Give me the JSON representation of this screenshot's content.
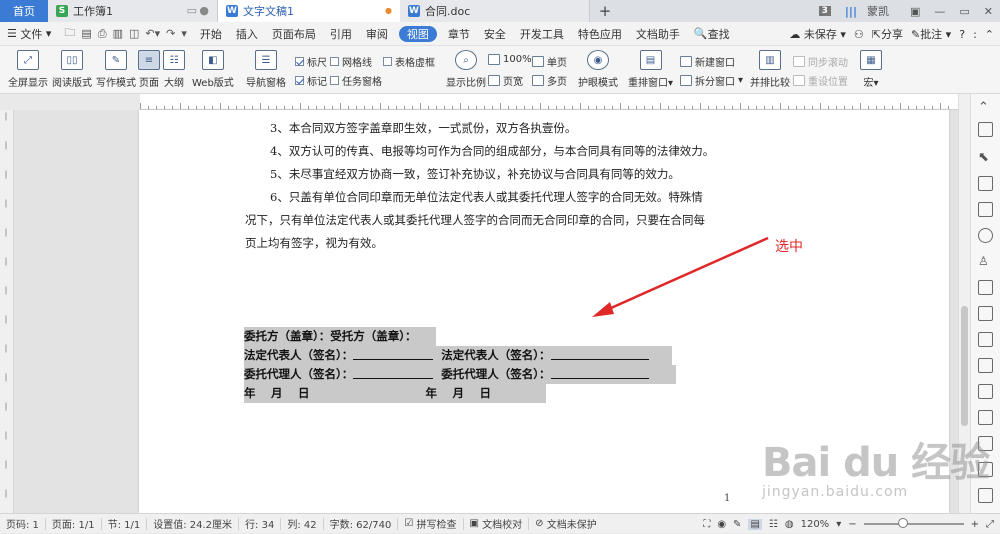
{
  "tabs": {
    "home": "首页",
    "sheet": "工作簿1",
    "doc": "文字文稿1",
    "contract": "合同.doc",
    "badge": "3",
    "user": "蒙凯"
  },
  "menu": {
    "file": "文件",
    "items": [
      "开始",
      "插入",
      "页面布局",
      "引用",
      "审阅",
      "视图",
      "章节",
      "安全",
      "开发工具",
      "特色应用",
      "文档助手"
    ],
    "active_index": 5,
    "search": "查找",
    "unsaved": "未保存",
    "share": "分享",
    "annotate": "批注",
    "help": "?"
  },
  "ribbon": {
    "fullscreen": "全屏显示",
    "reading": "阅读版式",
    "writing": "写作模式",
    "page": "页面",
    "outline": "大纲",
    "web": "Web版式",
    "nav": "导航窗格",
    "ruler": "标尺",
    "gridlines": "网格线",
    "table_lines": "表格虚框",
    "marks": "标记",
    "task_pane": "任务窗格",
    "zoom_ratio": "显示比例",
    "hundred": "100%",
    "page_width": "页宽",
    "single_page": "单页",
    "multi_page": "多页",
    "eye_mode": "护眼模式",
    "rearrange": "重排窗口",
    "new_window": "新建窗口",
    "split_window": "拆分窗口",
    "side_by_side": "并排比较",
    "sync_scroll": "同步滚动",
    "reset_pos": "重设位置",
    "macro": "宏"
  },
  "document": {
    "paragraphs": [
      "3、本合同双方签字盖章即生效，一式贰份，双方各执壹份。",
      "4、双方认可的传真、电报等均可作为合同的组成部分，与本合同具有同等的法律效力。",
      "5、未尽事宜经双方协商一致，签订补充协议，补充协议与合同具有同等的效力。",
      "6、只盖有单位合同印章而无单位法定代表人或其委托代理人签字的合同无效。特殊情",
      "况下，只有单位法定代表人或其委托代理人签字的合同而无合同印章的合同，只要在合同每",
      "页上均有签字，视为有效。"
    ],
    "selected": {
      "row1": "委托方（盖章）：受托方（盖章）：",
      "row2a": "法定代表人（签名）：",
      "row2b": "法定代表人（签名）：",
      "row3a": "委托代理人（签名）：",
      "row3b": "委托代理人（签名）：",
      "row4a": "年　 月　 日",
      "row4b": "年　 月　 日"
    },
    "page_number": "1",
    "annotation": "选中"
  },
  "status": {
    "page_code": "页码: 1",
    "pages": "页面: 1/1",
    "section": "节: 1/1",
    "setting": "设置值: 24.2厘米",
    "row": "行: 34",
    "col": "列: 42",
    "chars": "字数: 62/740",
    "spell": "拼写检查",
    "proof": "文档校对",
    "protect": "文档未保护",
    "zoom": "120%",
    "zoom_out": "−",
    "zoom_in": "+"
  },
  "watermark": {
    "brand": "Bai du 经验",
    "url": "jingyan.baidu.com"
  },
  "colors": {
    "accent": "#3b7bd5",
    "annotation": "#e02828",
    "selection": "#c9c9c9"
  }
}
